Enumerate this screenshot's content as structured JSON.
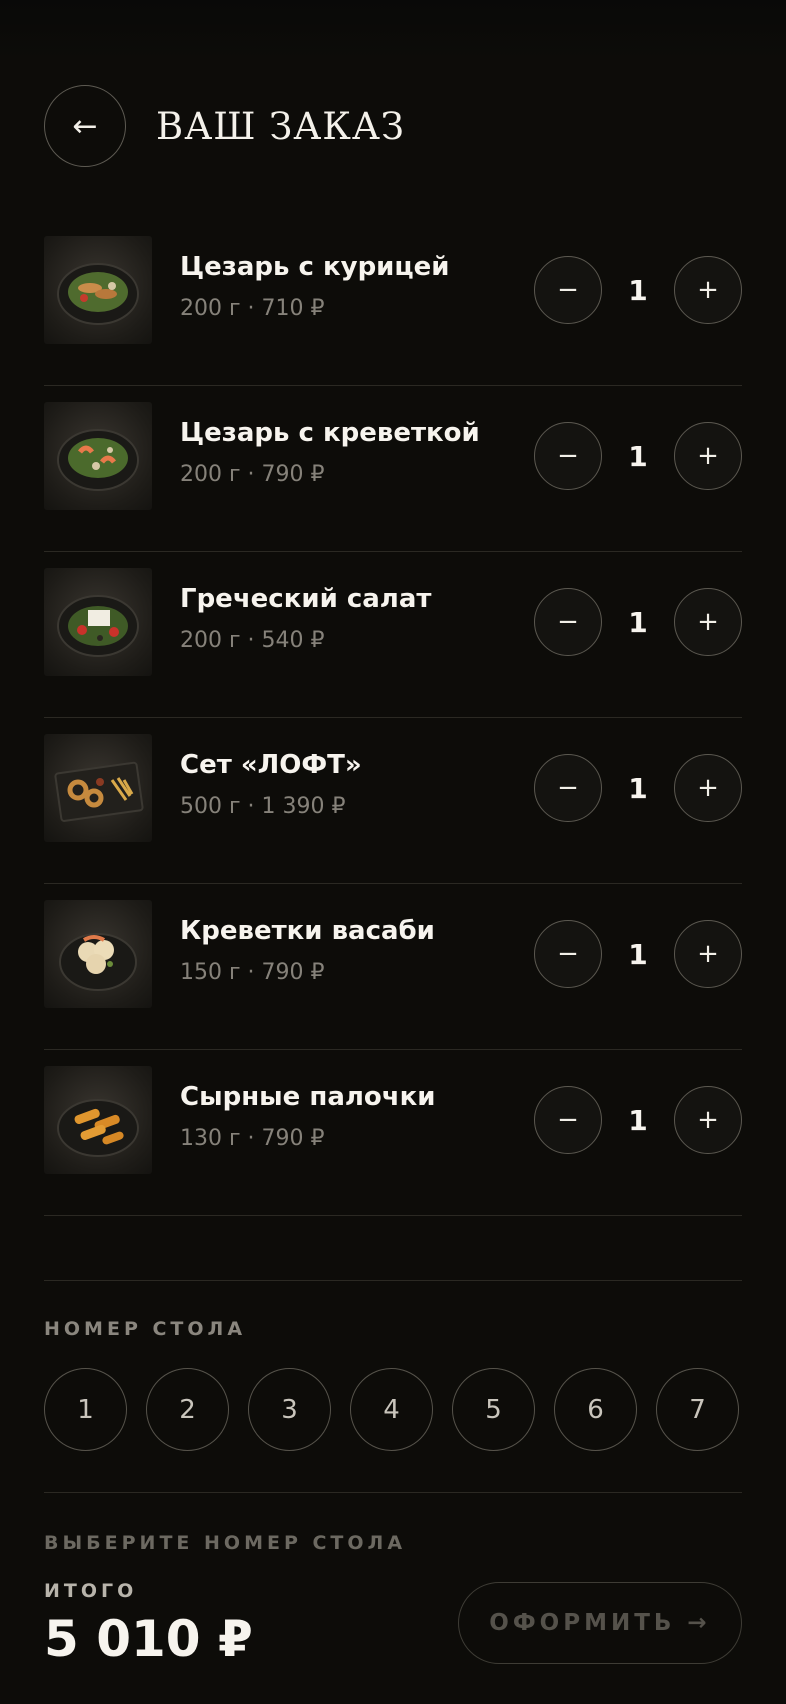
{
  "header": {
    "back_icon": "←",
    "title": "ВАШ ЗАКАЗ"
  },
  "items": [
    {
      "name": "Цезарь с курицей",
      "meta": "200 г · 710 ₽",
      "qty": "1",
      "minus": "−",
      "plus": "+",
      "image": "caesar-chicken"
    },
    {
      "name": "Цезарь с креветкой",
      "meta": "200 г · 790 ₽",
      "qty": "1",
      "minus": "−",
      "plus": "+",
      "image": "caesar-shrimp"
    },
    {
      "name": "Греческий салат",
      "meta": "200 г · 540 ₽",
      "qty": "1",
      "minus": "−",
      "plus": "+",
      "image": "greek-salad"
    },
    {
      "name": "Сет «ЛОФТ»",
      "meta": "500 г · 1 390 ₽",
      "qty": "1",
      "minus": "−",
      "plus": "+",
      "image": "loft-set"
    },
    {
      "name": "Креветки васаби",
      "meta": "150 г · 790 ₽",
      "qty": "1",
      "minus": "−",
      "plus": "+",
      "image": "wasabi-shrimp"
    },
    {
      "name": "Сырные палочки",
      "meta": "130 г · 790 ₽",
      "qty": "1",
      "minus": "−",
      "plus": "+",
      "image": "cheese-sticks"
    }
  ],
  "table_section": {
    "label": "НОМЕР СТОЛА",
    "tables": [
      "1",
      "2",
      "3",
      "4",
      "5",
      "6",
      "7"
    ]
  },
  "footer": {
    "hint": "ВЫБЕРИТЕ НОМЕР СТОЛА",
    "total_label": "ИТОГО",
    "total_value": "5 010 ₽",
    "checkout_label": "ОФОРМИТЬ →"
  },
  "colors": {
    "background": "#0d0c09",
    "text": "#f2efe8",
    "muted": "#86827a",
    "border": "#5b5850"
  }
}
